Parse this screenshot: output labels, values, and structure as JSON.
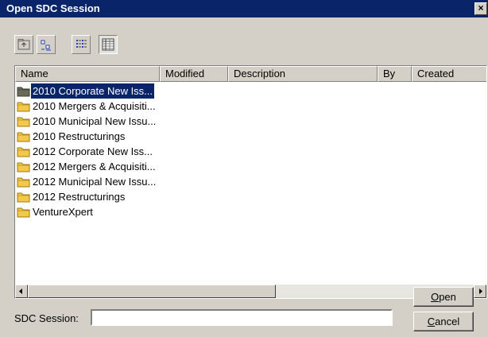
{
  "window": {
    "title": "Open SDC Session",
    "close_glyph": "×"
  },
  "toolbar": [
    {
      "name": "up-folder-button",
      "icon": "up-folder-icon"
    },
    {
      "name": "list-view-button",
      "icon": "list-view-icon"
    },
    {
      "name": "details-view-button",
      "icon": "details-view-icon"
    },
    {
      "name": "grid-view-button",
      "icon": "grid-view-icon"
    }
  ],
  "columns": [
    "Name",
    "Modified",
    "Description",
    "By",
    "Created"
  ],
  "files": [
    "2010 Corporate New Iss...",
    "2010 Mergers & Acquisiti...",
    "2010 Municipal New Issu...",
    "2010 Restructurings",
    "2012 Corporate New Iss...",
    "2012 Mergers & Acquisiti...",
    "2012 Municipal New Issu...",
    "2012 Restructurings",
    "VentureXpert"
  ],
  "selected_index": 0,
  "session": {
    "label": "SDC Session:",
    "value": ""
  },
  "buttons": {
    "open": {
      "accel": "O",
      "rest": "pen"
    },
    "cancel": {
      "accel": "C",
      "rest": "ancel"
    }
  },
  "colors": {
    "title_bar": "#0a246a",
    "folder": "#f2c94c",
    "selected_folder": "#6b6b5a"
  }
}
